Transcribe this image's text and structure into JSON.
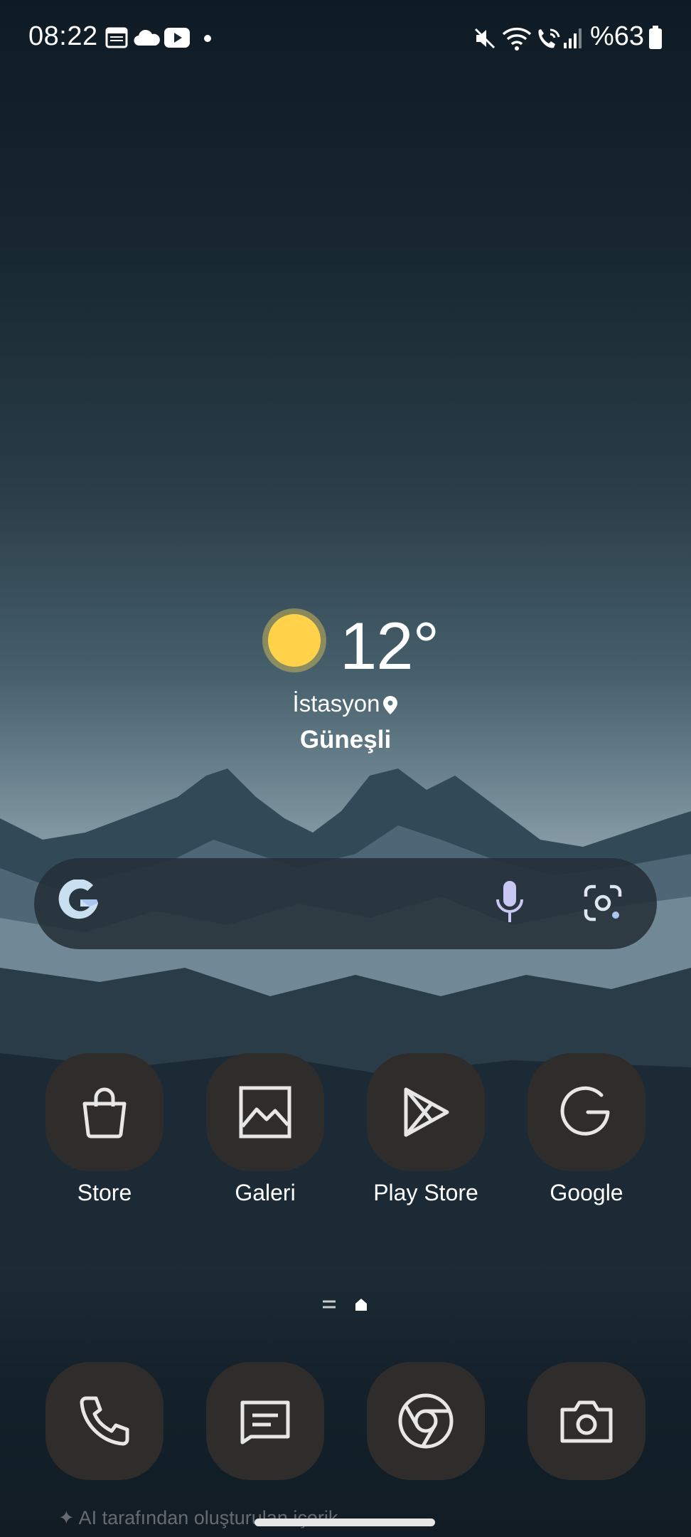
{
  "status_bar": {
    "time": "08:22",
    "left_icons": [
      "calendar-icon",
      "cloud-icon",
      "youtube-icon",
      "dot-icon"
    ],
    "right_icons": [
      "mute-icon",
      "wifi-icon",
      "wifi-calling-icon",
      "signal-icon",
      "battery-icon"
    ],
    "battery_percent": "%63"
  },
  "weather": {
    "icon": "sun-icon",
    "temperature": "12°",
    "location": "İstasyon",
    "condition": "Güneşli"
  },
  "search_bar": {
    "icons": [
      "google-icon",
      "microphone-icon",
      "google-lens-icon"
    ]
  },
  "apps": [
    {
      "label": "Store",
      "icon": "shopping-bag-icon"
    },
    {
      "label": "Galeri",
      "icon": "gallery-icon"
    },
    {
      "label": "Play Store",
      "icon": "play-store-icon"
    },
    {
      "label": "Google",
      "icon": "google-g-icon"
    }
  ],
  "dock": [
    {
      "icon": "phone-icon"
    },
    {
      "icon": "messages-icon"
    },
    {
      "icon": "chrome-icon"
    },
    {
      "icon": "camera-icon"
    }
  ],
  "footer": {
    "ai_note": "AI tarafından oluşturulan içerik"
  },
  "colors": {
    "tile": "#2e2d2c",
    "sun": "#ffd24a",
    "mic_accent": "#c9c8f5"
  }
}
